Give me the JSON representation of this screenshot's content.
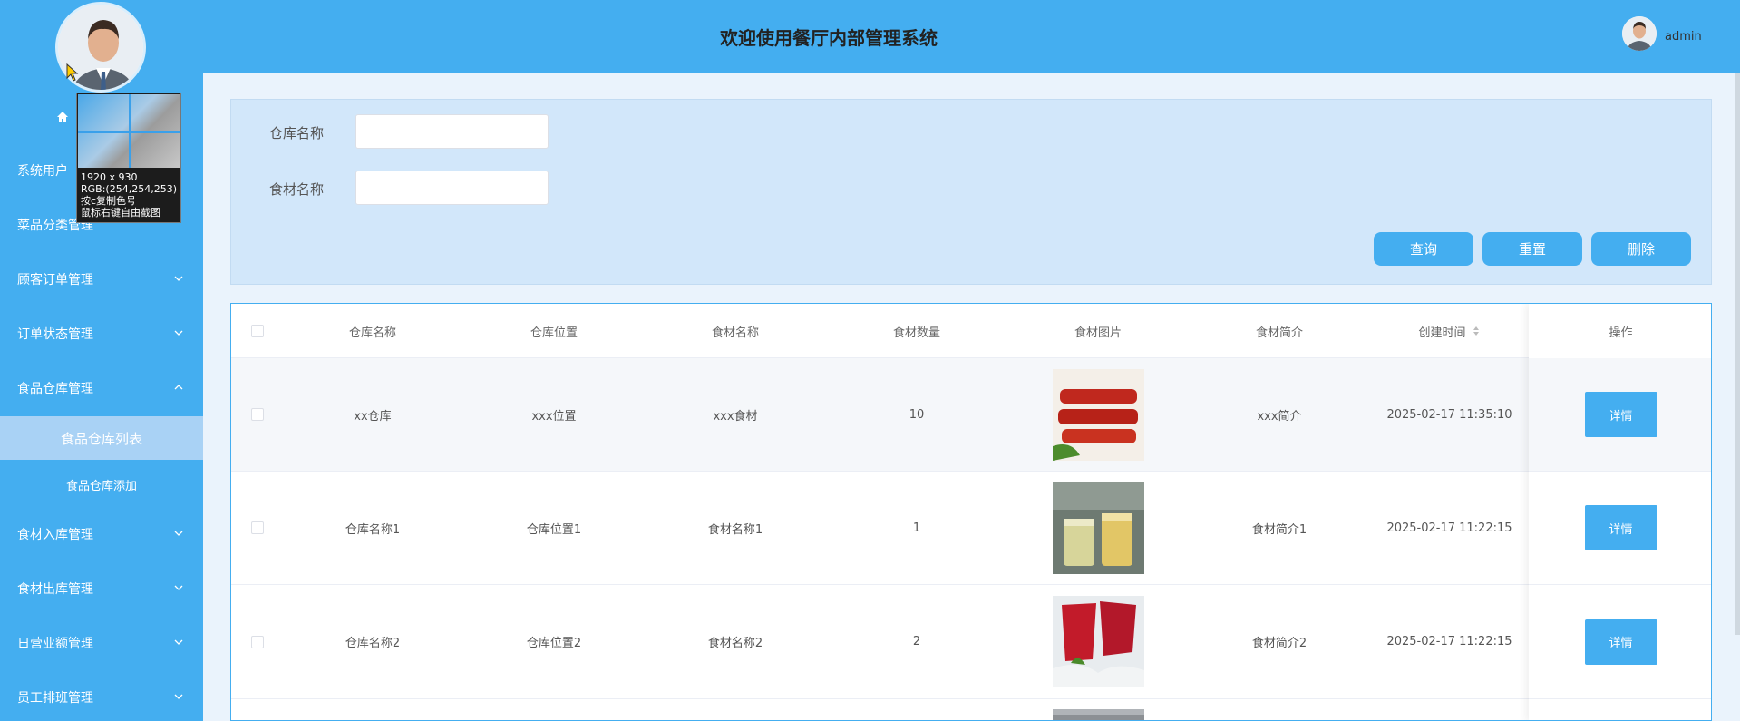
{
  "header": {
    "title": "欢迎使用餐厅内部管理系统",
    "user": "admin"
  },
  "sidebar": {
    "items": [
      {
        "label": "系统用户"
      },
      {
        "label": "菜品分类管理"
      },
      {
        "label": "顾客订单管理"
      },
      {
        "label": "订单状态管理"
      },
      {
        "label": "食品仓库管理"
      },
      {
        "label": "食材入库管理"
      },
      {
        "label": "食材出库管理"
      },
      {
        "label": "日营业额管理"
      },
      {
        "label": "员工排班管理"
      }
    ],
    "submenu": {
      "active": "食品仓库列表",
      "other": "食品仓库添加"
    }
  },
  "picker": {
    "line1": "1920 x 930",
    "line2": "RGB:(254,254,253)",
    "line3": "按c复制色号",
    "line4": "鼠标右键自由截图"
  },
  "search": {
    "warehouse_label": "仓库名称",
    "warehouse_value": "",
    "food_label": "食材名称",
    "food_value": "",
    "query_btn": "查询",
    "reset_btn": "重置",
    "delete_btn": "删除"
  },
  "table": {
    "headers": [
      "仓库名称",
      "仓库位置",
      "食材名称",
      "食材数量",
      "食材图片",
      "食材简介",
      "创建时间",
      "操作"
    ],
    "detail_label": "详情",
    "rows": [
      {
        "warehouse": "xx仓库",
        "location": "xxx位置",
        "food": "xxx食材",
        "qty": "10",
        "intro": "xxx简介",
        "created": "2025-02-17 11:35:10"
      },
      {
        "warehouse": "仓库名称1",
        "location": "仓库位置1",
        "food": "食材名称1",
        "qty": "1",
        "intro": "食材简介1",
        "created": "2025-02-17 11:22:15"
      },
      {
        "warehouse": "仓库名称2",
        "location": "仓库位置2",
        "food": "食材名称2",
        "qty": "2",
        "intro": "食材简介2",
        "created": "2025-02-17 11:22:15"
      }
    ]
  },
  "colors": {
    "primary": "#44aef0",
    "sidebar_active": "#a9d2f5",
    "panel": "#d2e7fa"
  }
}
